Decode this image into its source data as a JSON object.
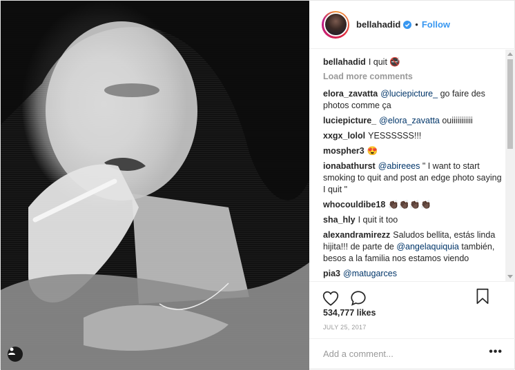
{
  "post": {
    "author": "bellahadid",
    "follow_label": "Follow",
    "separator": "•",
    "caption_text": "I quit 🚭",
    "load_more": "Load more comments",
    "comments": [
      {
        "author": "elora_zavatta",
        "mention": "@luciepicture_",
        "text": " go faire des photos comme ça"
      },
      {
        "author": "luciepicture_",
        "mention": "@elora_zavatta",
        "text": " ouiiiiiiiiiii"
      },
      {
        "author": "xxgx_lolol",
        "mention": "",
        "text": "YESSSSSS!!!"
      },
      {
        "author": "mospher3",
        "mention": "",
        "text": "😍"
      },
      {
        "author": "ionabathurst",
        "mention": "@abireees",
        "text": " \" I want to start smoking to quit and post an edge photo saying I quit \""
      },
      {
        "author": "whocouldibe18",
        "mention": "",
        "text": "👏🏿👏🏿👏🏿👏🏿"
      },
      {
        "author": "sha_hly",
        "mention": "",
        "text": "I quit it too"
      },
      {
        "author": "alexandramirezz",
        "mention": "",
        "text": "Saludos bellita, estás linda hijita!!! de parte de ",
        "mention2": "@angelaquiquia",
        "text2": " también, besos a la familia nos estamos viendo"
      },
      {
        "author": "pia3",
        "mention": "@matugarces",
        "text": ""
      }
    ],
    "likes": "534,777 likes",
    "date": "JULY 25, 2017",
    "add_comment_placeholder": "Add a comment...",
    "more_label": "•••"
  },
  "colors": {
    "link": "#3897f0",
    "verified": "#3897f0",
    "text": "#262626",
    "muted": "#999999"
  },
  "icons": {
    "heart": "heart-icon",
    "comment": "comment-icon",
    "bookmark": "bookmark-icon",
    "verified": "verified-badge-icon",
    "user_tag": "user-tag-icon"
  }
}
